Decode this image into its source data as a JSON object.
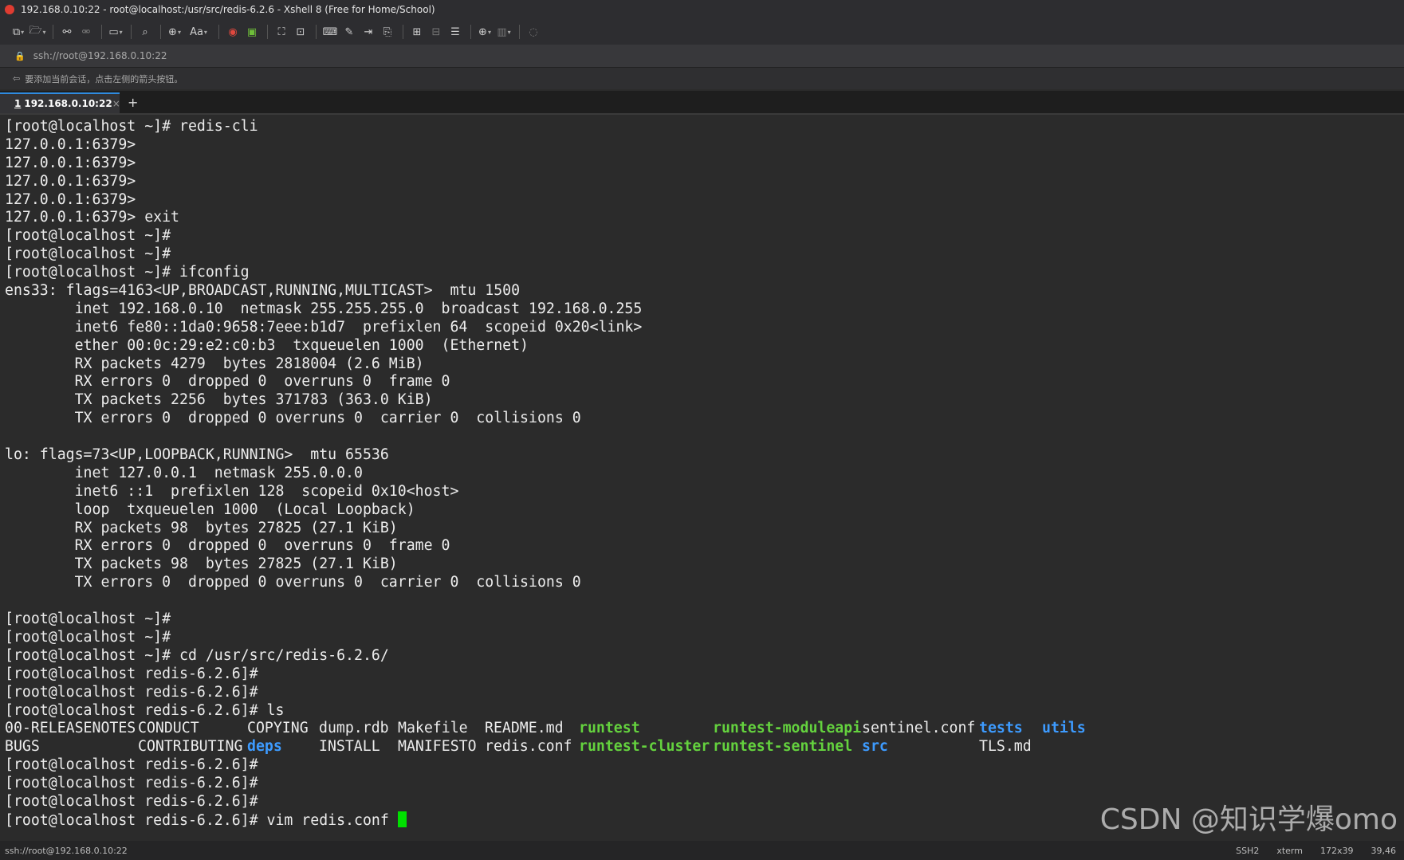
{
  "window": {
    "title": "192.168.0.10:22 - root@localhost:/usr/src/redis-6.2.6 - Xshell 8 (Free for Home/School)"
  },
  "address": {
    "url": "ssh://root@192.168.0.10:22"
  },
  "hint": {
    "text": "要添加当前会话，点击左侧的箭头按钮。"
  },
  "tabs": [
    {
      "index": "1",
      "label": "192.168.0.10:22",
      "close": "×"
    }
  ],
  "new_tab": "+",
  "terminal": {
    "lines_before_ls": [
      "[root@localhost ~]# redis-cli",
      "127.0.0.1:6379>",
      "127.0.0.1:6379>",
      "127.0.0.1:6379>",
      "127.0.0.1:6379>",
      "127.0.0.1:6379> exit",
      "[root@localhost ~]#",
      "[root@localhost ~]#",
      "[root@localhost ~]# ifconfig",
      "ens33: flags=4163<UP,BROADCAST,RUNNING,MULTICAST>  mtu 1500",
      "        inet 192.168.0.10  netmask 255.255.255.0  broadcast 192.168.0.255",
      "        inet6 fe80::1da0:9658:7eee:b1d7  prefixlen 64  scopeid 0x20<link>",
      "        ether 00:0c:29:e2:c0:b3  txqueuelen 1000  (Ethernet)",
      "        RX packets 4279  bytes 2818004 (2.6 MiB)",
      "        RX errors 0  dropped 0  overruns 0  frame 0",
      "        TX packets 2256  bytes 371783 (363.0 KiB)",
      "        TX errors 0  dropped 0 overruns 0  carrier 0  collisions 0",
      "",
      "lo: flags=73<UP,LOOPBACK,RUNNING>  mtu 65536",
      "        inet 127.0.0.1  netmask 255.0.0.0",
      "        inet6 ::1  prefixlen 128  scopeid 0x10<host>",
      "        loop  txqueuelen 1000  (Local Loopback)",
      "        RX packets 98  bytes 27825 (27.1 KiB)",
      "        RX errors 0  dropped 0  overruns 0  frame 0",
      "        TX packets 98  bytes 27825 (27.1 KiB)",
      "        TX errors 0  dropped 0 overruns 0  carrier 0  collisions 0",
      "",
      "[root@localhost ~]#",
      "[root@localhost ~]#",
      "[root@localhost ~]# cd /usr/src/redis-6.2.6/",
      "[root@localhost redis-6.2.6]#",
      "[root@localhost redis-6.2.6]#",
      "[root@localhost redis-6.2.6]# ls"
    ],
    "ls_rows": [
      [
        {
          "text": "00-RELEASENOTES",
          "type": "file"
        },
        {
          "text": "CONDUCT",
          "type": "file"
        },
        {
          "text": "COPYING",
          "type": "file"
        },
        {
          "text": "dump.rdb",
          "type": "file"
        },
        {
          "text": "Makefile",
          "type": "file"
        },
        {
          "text": "README.md",
          "type": "file"
        },
        {
          "text": "runtest",
          "type": "exec"
        },
        {
          "text": "runtest-moduleapi",
          "type": "exec"
        },
        {
          "text": "sentinel.conf",
          "type": "file"
        },
        {
          "text": "tests",
          "type": "dir"
        },
        {
          "text": "utils",
          "type": "dir"
        }
      ],
      [
        {
          "text": "BUGS",
          "type": "file"
        },
        {
          "text": "CONTRIBUTING",
          "type": "file"
        },
        {
          "text": "deps",
          "type": "dir"
        },
        {
          "text": "INSTALL",
          "type": "file"
        },
        {
          "text": "MANIFESTO",
          "type": "file"
        },
        {
          "text": "redis.conf",
          "type": "file"
        },
        {
          "text": "runtest-cluster",
          "type": "exec"
        },
        {
          "text": "runtest-sentinel",
          "type": "exec"
        },
        {
          "text": "src",
          "type": "dir"
        },
        {
          "text": "TLS.md",
          "type": "file"
        },
        {
          "text": "",
          "type": "file"
        }
      ]
    ],
    "lines_after_ls": [
      "[root@localhost redis-6.2.6]#",
      "[root@localhost redis-6.2.6]#",
      "[root@localhost redis-6.2.6]#"
    ],
    "current_prompt": "[root@localhost redis-6.2.6]# ",
    "current_input": "vim redis.conf "
  },
  "colors": {
    "executable": "#64d23e",
    "directory": "#3d9bff",
    "cursor": "#00e000",
    "tab_accent": "#2f8be0"
  },
  "watermark": "CSDN @知识学爆omo",
  "statusbar": {
    "path": "ssh://root@192.168.0.10:22",
    "protocol": "SSH2",
    "term": "xterm",
    "size": "172x39",
    "pos": "39,46"
  }
}
